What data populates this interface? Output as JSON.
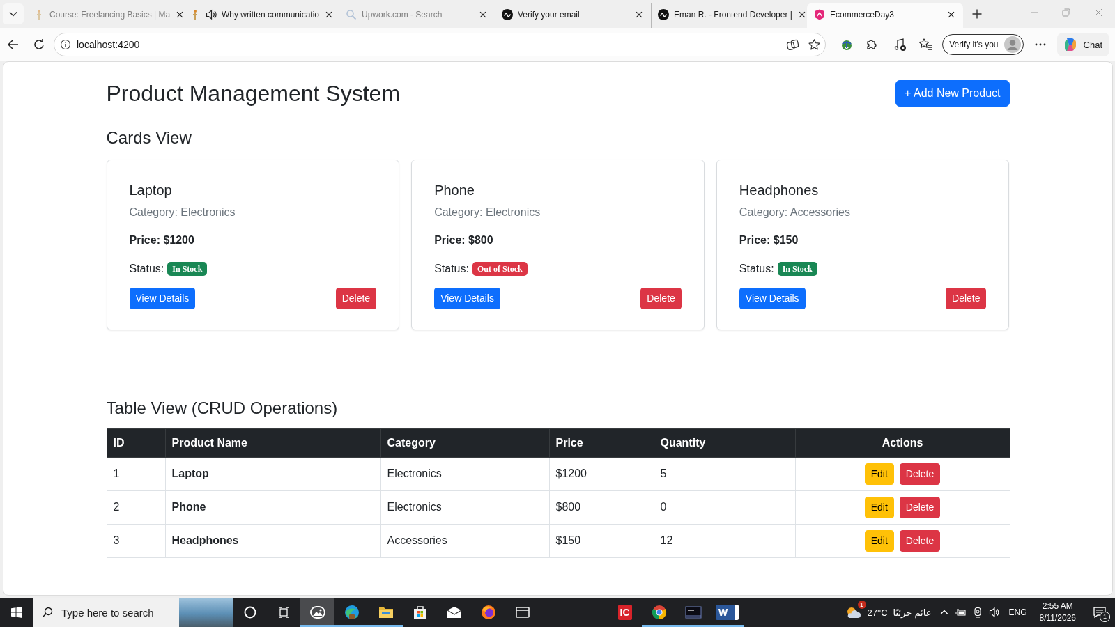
{
  "browser": {
    "tabs": [
      {
        "title": "Course: Freelancing Basics | Ma",
        "selected": false,
        "sleeping": true,
        "audio": false
      },
      {
        "title": "Why written communicatio",
        "selected": false,
        "sleeping": false,
        "audio": true
      },
      {
        "title": "Upwork.com - Search",
        "selected": false,
        "sleeping": true,
        "audio": false
      },
      {
        "title": "Verify your email",
        "selected": false,
        "sleeping": false,
        "audio": false
      },
      {
        "title": "Eman R. - Frontend Developer |",
        "selected": false,
        "sleeping": false,
        "audio": false
      },
      {
        "title": "EcommerceDay3",
        "selected": true,
        "sleeping": false,
        "audio": false
      }
    ],
    "address": "localhost:4200",
    "profile_button": "Verify it's you",
    "chat_button": "Chat"
  },
  "page": {
    "title": "Product Management System",
    "add_button": "+ Add New Product",
    "cards_heading": "Cards View",
    "cards": [
      {
        "name": "Laptop",
        "category": "Category: Electronics",
        "price": "Price: $1200",
        "status_label": "Status:",
        "status": "In Stock",
        "in_stock": true,
        "view_button": "View Details",
        "delete_button": "Delete"
      },
      {
        "name": "Phone",
        "category": "Category: Electronics",
        "price": "Price: $800",
        "status_label": "Status:",
        "status": "Out of Stock",
        "in_stock": false,
        "view_button": "View Details",
        "delete_button": "Delete"
      },
      {
        "name": "Headphones",
        "category": "Category: Accessories",
        "price": "Price: $150",
        "status_label": "Status:",
        "status": "In Stock",
        "in_stock": true,
        "view_button": "View Details",
        "delete_button": "Delete"
      }
    ],
    "table_heading": "Table View (CRUD Operations)",
    "table": {
      "columns": [
        "ID",
        "Product Name",
        "Category",
        "Price",
        "Quantity",
        "Actions"
      ],
      "rows": [
        {
          "cells": [
            "1",
            "Laptop",
            "Electronics",
            "$1200",
            "5"
          ],
          "edit_button": "Edit",
          "delete_button": "Delete"
        },
        {
          "cells": [
            "2",
            "Phone",
            "Electronics",
            "$800",
            "0"
          ],
          "edit_button": "Edit",
          "delete_button": "Delete"
        },
        {
          "cells": [
            "3",
            "Headphones",
            "Accessories",
            "$150",
            "12"
          ],
          "edit_button": "Edit",
          "delete_button": "Delete"
        }
      ]
    }
  },
  "taskbar": {
    "search": {
      "placeholder": "Type here to search"
    },
    "apps": [
      {
        "running": true,
        "selected": true
      },
      {
        "running": true,
        "selected": false
      },
      {
        "running": true,
        "selected": false
      },
      {
        "running": false,
        "selected": false
      },
      {
        "running": false,
        "selected": false
      },
      {
        "running": false,
        "selected": false
      },
      {
        "running": false,
        "selected": false
      },
      {
        "label": "IC",
        "running": false,
        "selected": false
      },
      {
        "running": true,
        "selected": false
      },
      {
        "running": true,
        "selected": false
      },
      {
        "label": "W",
        "running": true,
        "selected": false
      }
    ],
    "weather": {
      "badge": "1",
      "temperature": "27°C",
      "condition": "غائم جزئيًا"
    },
    "language": "ENG",
    "time": "2:55 AM",
    "date": "8/11/2026",
    "notifications": "1"
  }
}
